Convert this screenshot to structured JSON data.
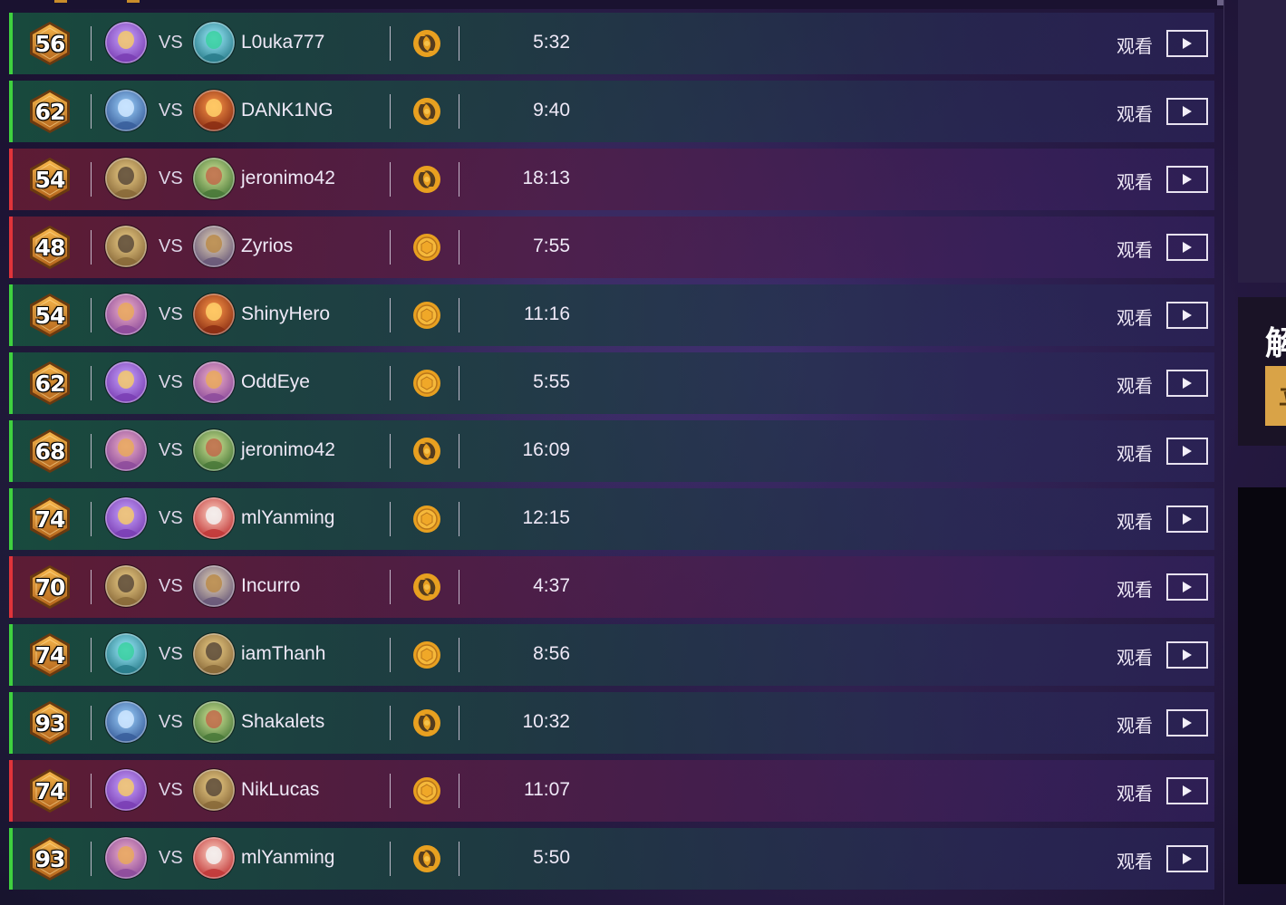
{
  "watch_label": "观看",
  "vs_label": "VS",
  "sidebar": {
    "heading_char": "解",
    "button_char": "立"
  },
  "colors": {
    "win": "#3fd13f",
    "loss": "#e0343a",
    "accent_gold": "#d9a347",
    "mode_icon": "#e8a020"
  },
  "matches": [
    {
      "result": "win",
      "rank": "56",
      "hero": "mage",
      "opp_hero": "shaman",
      "opponent": "L0uka777",
      "mode": "swirl-icon",
      "duration": "5:32"
    },
    {
      "result": "win",
      "rank": "62",
      "hero": "priest",
      "opp_hero": "warlock",
      "opponent": "DANK1NG",
      "mode": "swirl-icon",
      "duration": "9:40"
    },
    {
      "result": "loss",
      "rank": "54",
      "hero": "paladin",
      "opp_hero": "hunter",
      "opponent": "jeronimo42",
      "mode": "swirl-icon",
      "duration": "18:13"
    },
    {
      "result": "loss",
      "rank": "48",
      "hero": "paladin",
      "opp_hero": "warrior",
      "opponent": "Zyrios",
      "mode": "coin-icon",
      "duration": "7:55"
    },
    {
      "result": "win",
      "rank": "54",
      "hero": "rogue",
      "opp_hero": "warlock",
      "opponent": "ShinyHero",
      "mode": "coin-icon",
      "duration": "11:16"
    },
    {
      "result": "win",
      "rank": "62",
      "hero": "mage",
      "opp_hero": "rogue",
      "opponent": "OddEye",
      "mode": "coin-icon",
      "duration": "5:55"
    },
    {
      "result": "win",
      "rank": "68",
      "hero": "rogue",
      "opp_hero": "hunter",
      "opponent": "jeronimo42",
      "mode": "swirl-icon",
      "duration": "16:09"
    },
    {
      "result": "win",
      "rank": "74",
      "hero": "mage",
      "opp_hero": "druid",
      "opponent": "mlYanming",
      "mode": "coin-icon",
      "duration": "12:15"
    },
    {
      "result": "loss",
      "rank": "70",
      "hero": "paladin",
      "opp_hero": "warrior",
      "opponent": "Incurro",
      "mode": "swirl-icon",
      "duration": "4:37"
    },
    {
      "result": "win",
      "rank": "74",
      "hero": "shaman",
      "opp_hero": "paladin",
      "opponent": "iamThanh",
      "mode": "coin-icon",
      "duration": "8:56"
    },
    {
      "result": "win",
      "rank": "93",
      "hero": "priest",
      "opp_hero": "hunter",
      "opponent": "Shakalets",
      "mode": "swirl-icon",
      "duration": "10:32"
    },
    {
      "result": "loss",
      "rank": "74",
      "hero": "mage",
      "opp_hero": "paladin",
      "opponent": "NikLucas",
      "mode": "coin-icon",
      "duration": "11:07"
    },
    {
      "result": "win",
      "rank": "93",
      "hero": "rogue",
      "opp_hero": "druid",
      "opponent": "mlYanming",
      "mode": "swirl-icon",
      "duration": "5:50"
    }
  ]
}
